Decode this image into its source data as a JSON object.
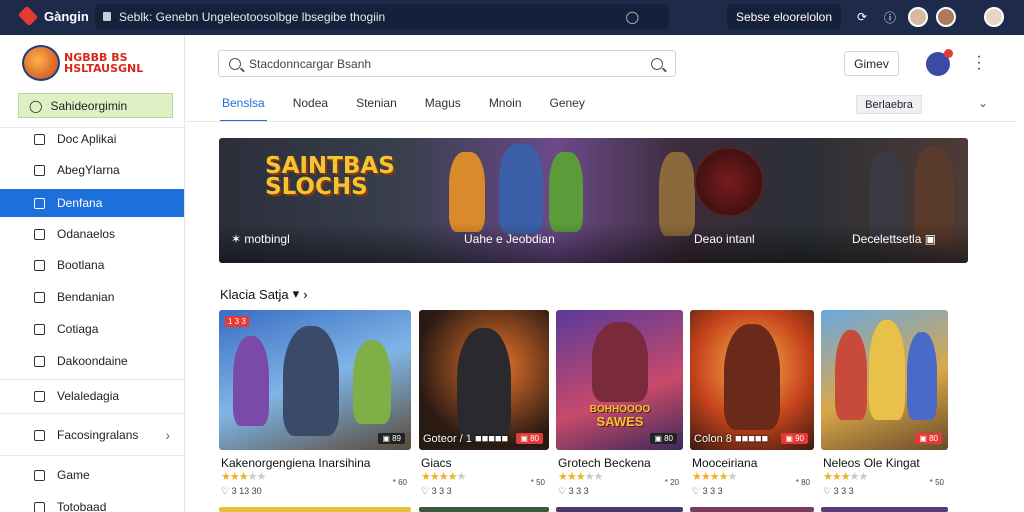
{
  "topbar": {
    "brand": "Gàngin",
    "url": "Seblk: Genebn Ungeleotoosolbge lbsegibe thogiin",
    "pill": "Sebse eloorelolon",
    "icons": [
      "refresh-icon",
      "info-icon",
      "user-avatar",
      "user-avatar",
      "profile-avatar"
    ]
  },
  "sidebar": {
    "logo_text": [
      "NGBBB BS",
      "HSLTAUSGNL"
    ],
    "primary": "Sahideorgimin",
    "items": [
      {
        "label": "Doc Aplikai",
        "icon": "document-icon"
      },
      {
        "label": "AbegYlarna",
        "icon": "folder-icon"
      },
      {
        "label": "Denfana",
        "icon": "square-icon",
        "active": true
      },
      {
        "label": "Odanaelos",
        "icon": "clipboard-icon"
      },
      {
        "label": "Bootlana",
        "icon": "note-icon"
      },
      {
        "label": "Bendanian",
        "icon": "list-icon"
      },
      {
        "label": "Cotiaga",
        "icon": "checkbox-icon"
      },
      {
        "label": "Dakoondaine",
        "icon": "file-icon"
      },
      {
        "label": "Velaledagia",
        "icon": "tag-icon"
      },
      {
        "label": "Facosingralans",
        "icon": "stack-icon",
        "has_chevron": true
      },
      {
        "label": "Game",
        "icon": "box-icon"
      },
      {
        "label": "Totobaad",
        "icon": "file-icon"
      }
    ]
  },
  "header": {
    "search_placeholder": "Stacdonncargar Bsanh",
    "button": "Gimev"
  },
  "tabs": {
    "items": [
      "Benslsa",
      "Nodea",
      "Stenian",
      "Magus",
      "Mnoin",
      "Geney"
    ],
    "active": 0,
    "select": "Berlaebra"
  },
  "banner": {
    "title_line1": "SAINTBAS",
    "title_line2": "SLOCHS",
    "captions": [
      "✶ motbingl",
      "Uahe e Jeobdian",
      "Deao intanl",
      "Decelettsetla ▣"
    ]
  },
  "section": {
    "title": "Klacia Satja",
    "caret": "▾",
    "arrow": "›"
  },
  "cards": [
    {
      "name": "Kakenorgengiena Inarsihina",
      "rating": 3.5,
      "count": "* 60",
      "sub": "♡ 3 13 30",
      "badge": "▣ 89",
      "overlay": "",
      "top_badge": "1 3 3"
    },
    {
      "name": "Giacs",
      "rating": 4,
      "count": "* 50",
      "sub": "♡ 3 3 3",
      "badge": "▣ 80",
      "overlay": "Goteor / 1 ■■■■■"
    },
    {
      "name": "Grotech Beckena",
      "rating": 3,
      "count": "* 20",
      "sub": "♡ 3 3 3",
      "badge": "▣ 80",
      "overlay": "",
      "mid_text": [
        "BOHHOOOO",
        "SAWES"
      ]
    },
    {
      "name": "Mooceiriana",
      "rating": 4,
      "count": "* 80",
      "sub": "♡ 3 3 3",
      "badge": "▣ 90",
      "overlay": "Colon 8 ■■■■■"
    },
    {
      "name": "Neleos Ole Kingat",
      "rating": 3,
      "count": "* 50",
      "sub": "♡ 3 3 3",
      "badge": "▣ 80",
      "overlay": ""
    }
  ],
  "colors": {
    "topbar": "#1e2a4a",
    "accent": "#1d6fdc",
    "primary_chip": "#dff0c4",
    "star": "#f2b01e",
    "badge": "#e53935"
  }
}
